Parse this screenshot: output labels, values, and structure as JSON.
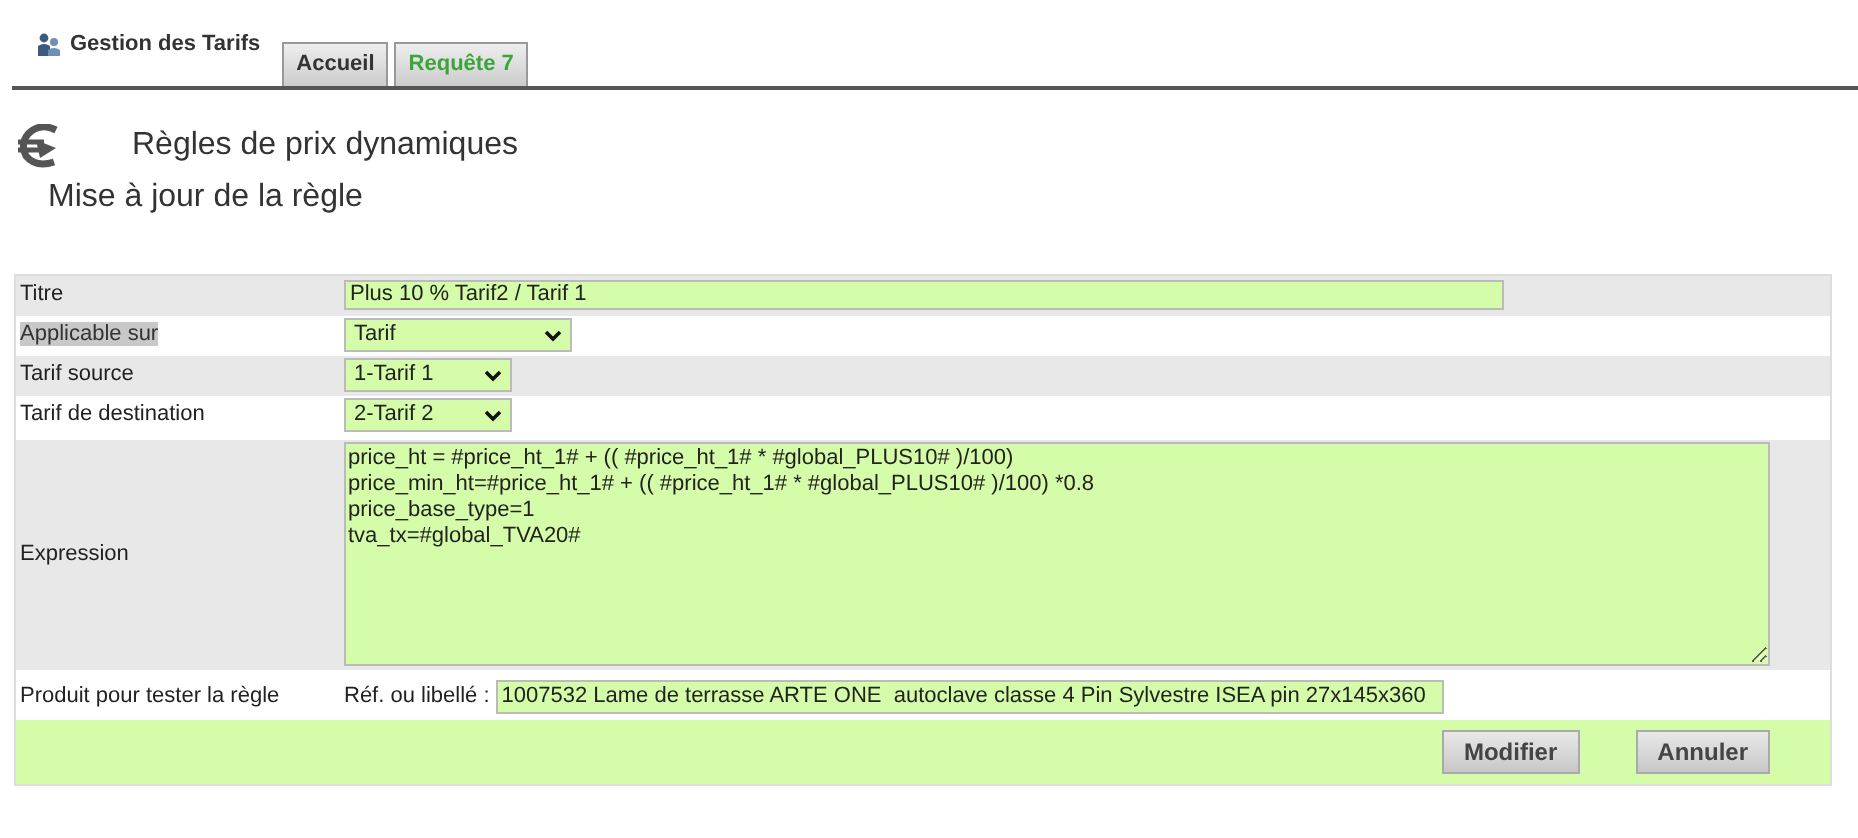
{
  "app": {
    "title": "Gestion des Tarifs"
  },
  "tabs": [
    {
      "label": "Accueil",
      "selected": false
    },
    {
      "label": "Requête 7",
      "selected": true
    }
  ],
  "page": {
    "title": "Règles de prix dynamiques",
    "subtitle": "Mise à jour de la règle"
  },
  "form": {
    "rows": [
      {
        "kind": "text",
        "label": "Titre",
        "value": "Plus 10 % Tarif2 / Tarif 1"
      },
      {
        "kind": "select",
        "label": "Applicable sur",
        "value": "Tarif",
        "highlighted": true
      },
      {
        "kind": "select",
        "label": "Tarif source",
        "value": "1-Tarif 1",
        "highlighted": false
      },
      {
        "kind": "select",
        "label": "Tarif de destination",
        "value": "2-Tarif 2",
        "highlighted": false
      },
      {
        "kind": "textarea",
        "label": "Expression",
        "lines": [
          "price_ht = #price_ht_1# + (( #price_ht_1# * #global_PLUS10# )/100)",
          "price_min_ht=#price_ht_1# + (( #price_ht_1# * #global_PLUS10# )/100) *0.8",
          "price_base_type=1",
          "tva_tx=#global_TVA20#"
        ]
      },
      {
        "kind": "product",
        "label": "Produit pour tester la règle",
        "prefix": "Réf. ou libellé :",
        "value": "1007532 Lame de terrasse ARTE ONE  autoclave classe 4 Pin Sylvestre ISEA pin 27x145x360"
      }
    ]
  },
  "buttons": [
    "Modifier",
    "Annuler"
  ]
}
